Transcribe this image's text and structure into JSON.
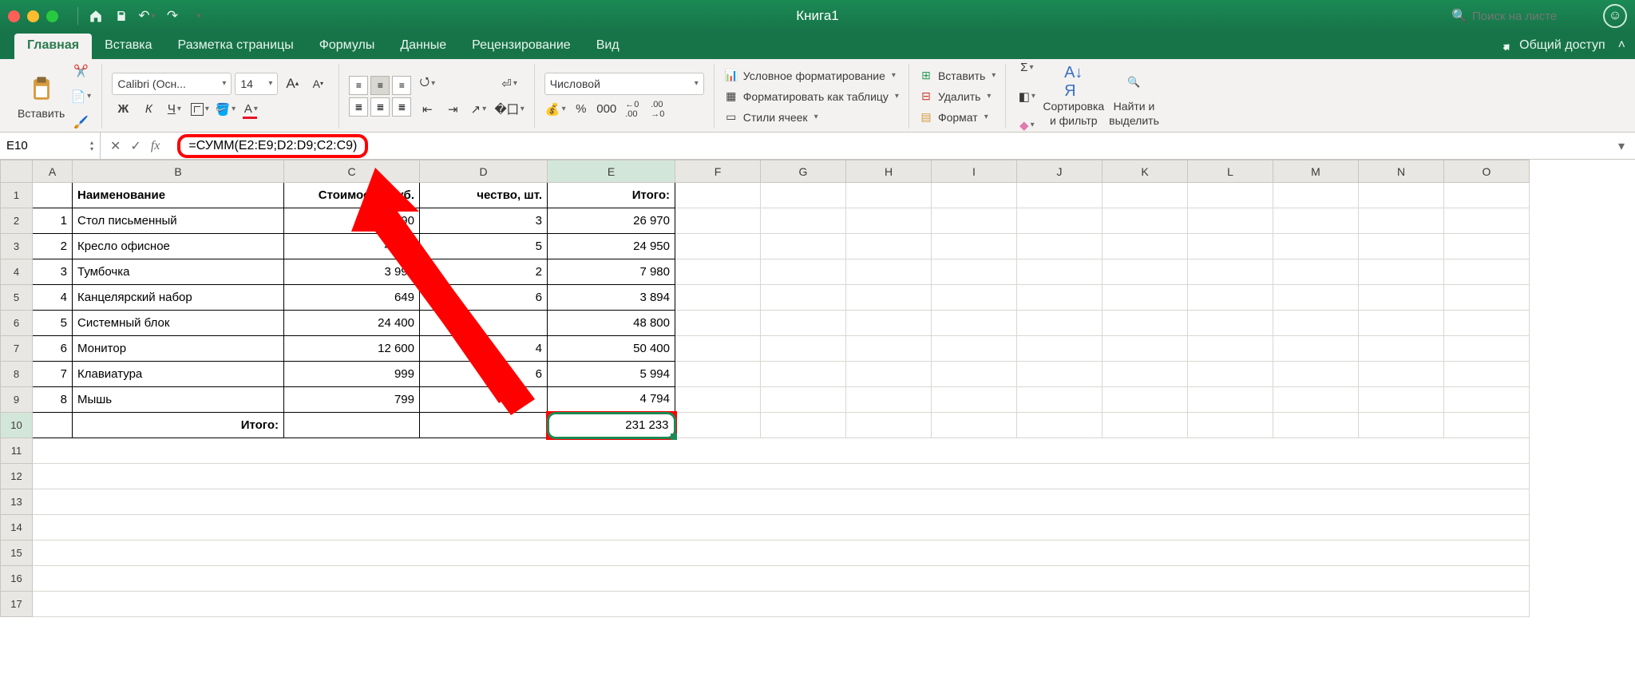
{
  "window": {
    "title": "Книга1",
    "search_placeholder": "Поиск на листе"
  },
  "tabs": {
    "items": [
      "Главная",
      "Вставка",
      "Разметка страницы",
      "Формулы",
      "Данные",
      "Рецензирование",
      "Вид"
    ],
    "active": 0,
    "share": "Общий доступ"
  },
  "ribbon": {
    "paste": "Вставить",
    "font_name": "Calibri (Осн...",
    "font_size": "14",
    "bold": "Ж",
    "italic": "К",
    "underline": "Ч",
    "number_format": "Числовой",
    "cond_fmt": "Условное форматирование",
    "as_table": "Форматировать как таблицу",
    "cell_styles": "Стили ячеек",
    "insert": "Вставить",
    "delete": "Удалить",
    "format": "Формат",
    "sort": "Сортировка",
    "filter_l2": "и фильтр",
    "find": "Найти и",
    "find_l2": "выделить"
  },
  "formula_bar": {
    "cell_ref": "E10",
    "formula": "=СУММ(E2:E9;D2:D9;C2:C9)"
  },
  "columns": [
    "A",
    "B",
    "C",
    "D",
    "E",
    "F",
    "G",
    "H",
    "I",
    "J",
    "K",
    "L",
    "M",
    "N",
    "O"
  ],
  "headers": {
    "b": "Наименование",
    "c": "Стоимость, руб.",
    "d": "чество, шт.",
    "e": "Итого:"
  },
  "rows": [
    {
      "n": "1",
      "a": "1",
      "name": "Стол письменный",
      "cost": "8 990",
      "qty": "3",
      "total": "26 970"
    },
    {
      "n": "2",
      "a": "2",
      "name": "Кресло офисное",
      "cost": "4 990",
      "qty": "5",
      "total": "24 950"
    },
    {
      "n": "3",
      "a": "3",
      "name": "Тумбочка",
      "cost": "3 990",
      "qty": "2",
      "total": "7 980"
    },
    {
      "n": "4",
      "a": "4",
      "name": "Канцелярский набор",
      "cost": "649",
      "qty": "6",
      "total": "3 894"
    },
    {
      "n": "5",
      "a": "5",
      "name": "Системный блок",
      "cost": "24 400",
      "qty": "",
      "total": "48 800"
    },
    {
      "n": "6",
      "a": "6",
      "name": "Монитор",
      "cost": "12 600",
      "qty": "4",
      "total": "50 400"
    },
    {
      "n": "7",
      "a": "7",
      "name": "Клавиатура",
      "cost": "999",
      "qty": "6",
      "total": "5 994"
    },
    {
      "n": "8",
      "a": "8",
      "name": "Мышь",
      "cost": "799",
      "qty": "",
      "total": "4 794"
    }
  ],
  "footer": {
    "label": "Итого:",
    "sum": "231 233"
  },
  "row_numbers_extra": [
    "11",
    "12",
    "13",
    "14",
    "15",
    "16",
    "17"
  ]
}
